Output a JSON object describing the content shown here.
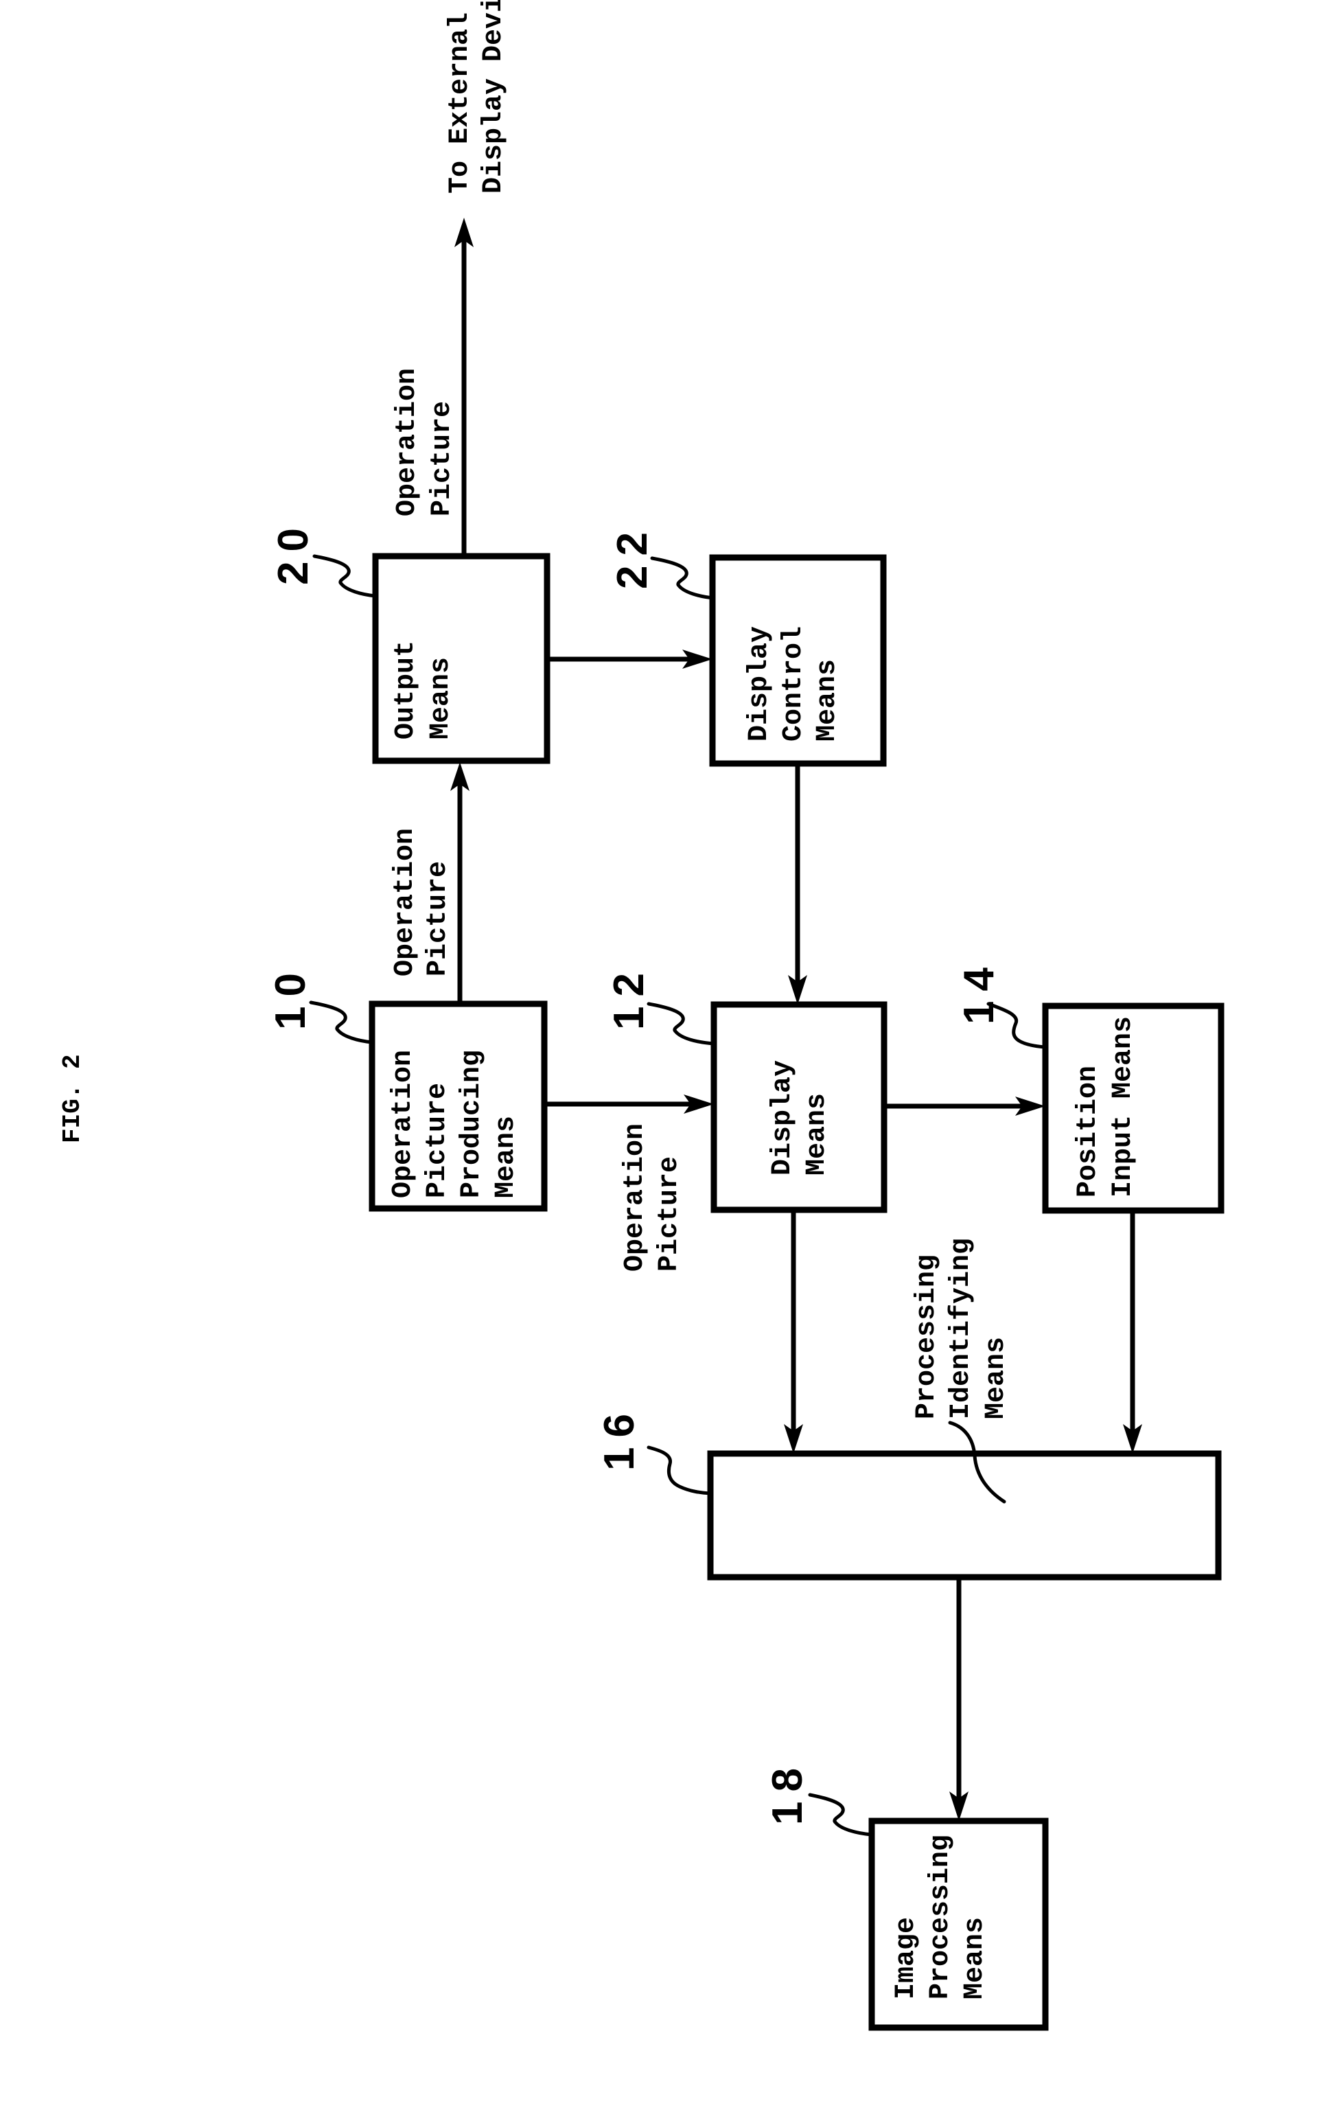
{
  "figure": {
    "title": "FIG. 2"
  },
  "boxes": {
    "b10": {
      "ref": "10",
      "label_lines": [
        "Operation",
        "Picture",
        "Producing",
        "Means"
      ]
    },
    "b12": {
      "ref": "12",
      "label_lines": [
        "Display",
        "Means"
      ]
    },
    "b14": {
      "ref": "14",
      "label_lines": [
        "Position",
        "Input Means"
      ]
    },
    "b16": {
      "ref": "16",
      "label_lines": [
        "Processing",
        "Identifying",
        "Means"
      ]
    },
    "b18": {
      "ref": "18",
      "label_lines": [
        "Image",
        "Processing",
        "Means"
      ]
    },
    "b20": {
      "ref": "20",
      "label_lines": [
        "Output",
        "Means"
      ]
    },
    "b22": {
      "ref": "22",
      "label_lines": [
        "Display",
        "Control",
        "Means"
      ]
    }
  },
  "edges": [
    {
      "from": "10",
      "to": "20",
      "label_lines": [
        "Operation",
        "Picture"
      ]
    },
    {
      "from": "20",
      "to": "external",
      "label_lines": [
        "Operation",
        "Picture"
      ]
    },
    {
      "from": "20",
      "to": "22",
      "label_lines": []
    },
    {
      "from": "10",
      "to": "12",
      "label_lines": [
        "Operation",
        "Picture"
      ]
    },
    {
      "from": "22",
      "to": "12",
      "label_lines": []
    },
    {
      "from": "12",
      "to": "14",
      "label_lines": []
    },
    {
      "from": "12",
      "to": "16",
      "label_lines": []
    },
    {
      "from": "14",
      "to": "16",
      "label_lines": []
    },
    {
      "from": "16",
      "to": "18",
      "label_lines": []
    }
  ],
  "external": {
    "label_lines": [
      "To External",
      "Display Device"
    ]
  }
}
